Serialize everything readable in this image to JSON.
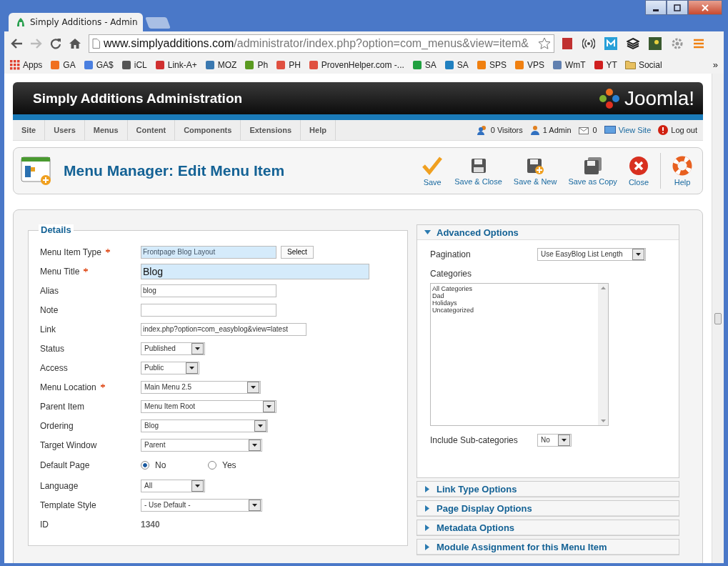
{
  "browser": {
    "tabs": [
      {
        "title": "Simply Additions - Admin",
        "selected": true
      }
    ],
    "url_host": "www.simplyadditions.com",
    "url_path": "/administrator/index.php?option=com_menus&view=item&",
    "bookmarks": [
      {
        "label": "Apps",
        "kind": "apps",
        "color": "#e04030"
      },
      {
        "label": "GA",
        "kind": "site",
        "color": "#f07020"
      },
      {
        "label": "GA$",
        "kind": "site",
        "color": "#4a7fe0"
      },
      {
        "label": "iCL",
        "kind": "site",
        "color": "#555555"
      },
      {
        "label": "Link-A+",
        "kind": "site",
        "color": "#d03030"
      },
      {
        "label": "MOZ",
        "kind": "site",
        "color": "#3a78b0"
      },
      {
        "label": "Ph",
        "kind": "site",
        "color": "#5a9a20"
      },
      {
        "label": "PH",
        "kind": "site",
        "color": "#e05040"
      },
      {
        "label": "ProvenHelper.com -...",
        "kind": "site",
        "color": "#e05040"
      },
      {
        "label": "SA",
        "kind": "site",
        "color": "#20a040"
      },
      {
        "label": "SA",
        "kind": "site",
        "color": "#2080c0"
      },
      {
        "label": "SPS",
        "kind": "site",
        "color": "#f08010"
      },
      {
        "label": "VPS",
        "kind": "site",
        "color": "#f08010"
      },
      {
        "label": "WmT",
        "kind": "site",
        "color": "#6080b0"
      },
      {
        "label": "YT",
        "kind": "site",
        "color": "#d02020"
      },
      {
        "label": "Social",
        "kind": "folder",
        "color": "#e8c060"
      }
    ],
    "more": "»"
  },
  "header": {
    "title": "Simply Additions Administration",
    "logo": "Joomla!"
  },
  "menu": [
    "Site",
    "Users",
    "Menus",
    "Content",
    "Components",
    "Extensions",
    "Help"
  ],
  "status": [
    {
      "text": "0 Visitors",
      "kind": "users"
    },
    {
      "text": "1 Admin",
      "kind": "user"
    },
    {
      "text": "0",
      "kind": "mail"
    },
    {
      "text": "View Site",
      "kind": "link"
    },
    {
      "text": "Log out",
      "kind": "logout"
    }
  ],
  "toolbar": {
    "title": "Menu Manager: Edit Menu Item",
    "buttons": [
      {
        "label": "Save",
        "kind": "check"
      },
      {
        "label": "Save & Close",
        "kind": "disk"
      },
      {
        "label": "Save & New",
        "kind": "disk-plus"
      },
      {
        "label": "Save as Copy",
        "kind": "copy"
      },
      {
        "label": "Close",
        "kind": "close"
      },
      {
        "label": "Help",
        "kind": "help"
      }
    ]
  },
  "details": {
    "legend": "Details",
    "fields": [
      {
        "label": "Menu Item Type",
        "required": true,
        "kind": "picker",
        "value": "Frontpage Blog Layout",
        "button": "Select"
      },
      {
        "label": "Menu Title",
        "required": true,
        "kind": "title",
        "value": "Blog"
      },
      {
        "label": "Alias",
        "required": false,
        "kind": "text",
        "value": "blog"
      },
      {
        "label": "Note",
        "required": false,
        "kind": "text"
      },
      {
        "label": "Link",
        "required": false,
        "kind": "text",
        "value": "index.php?option=com_easyblog&view=latest"
      },
      {
        "label": "Status",
        "required": false,
        "kind": "select",
        "value": "Published"
      },
      {
        "label": "Access",
        "required": false,
        "kind": "select",
        "value": "Public"
      },
      {
        "label": "Menu Location",
        "required": true,
        "kind": "select",
        "value": "Main Menu 2.5"
      },
      {
        "label": "Parent Item",
        "required": false,
        "kind": "select",
        "value": "Menu Item Root"
      },
      {
        "label": "Ordering",
        "required": false,
        "kind": "select",
        "value": "Blog"
      },
      {
        "label": "Target Window",
        "required": false,
        "kind": "select",
        "value": "Parent"
      },
      {
        "label": "Default Page",
        "required": false,
        "kind": "radio",
        "options": [
          {
            "label": "No",
            "selected": true
          },
          {
            "label": "Yes",
            "selected": false
          }
        ]
      },
      {
        "label": "Language",
        "required": false,
        "kind": "select",
        "value": "All"
      },
      {
        "label": "Template Style",
        "required": false,
        "kind": "select",
        "value": "- Use Default -"
      },
      {
        "label": "ID",
        "required": false,
        "kind": "static",
        "value": "1340"
      }
    ]
  },
  "panels": [
    {
      "title": "Advanced Options",
      "expanded": true,
      "pagination_label": "Pagination",
      "pagination": "Use EasyBlog List Length",
      "categories_label": "Categories",
      "categories": [
        "All Categories",
        "Dad",
        "Holidays",
        "Uncategorized"
      ],
      "subcategories_label": "Include Sub-categories",
      "subcategories": "No"
    },
    {
      "title": "Link Type Options",
      "expanded": false
    },
    {
      "title": "Page Display Options",
      "expanded": false
    },
    {
      "title": "Metadata Options",
      "expanded": false
    },
    {
      "title": "Module Assignment for this Menu Item",
      "expanded": false
    }
  ]
}
